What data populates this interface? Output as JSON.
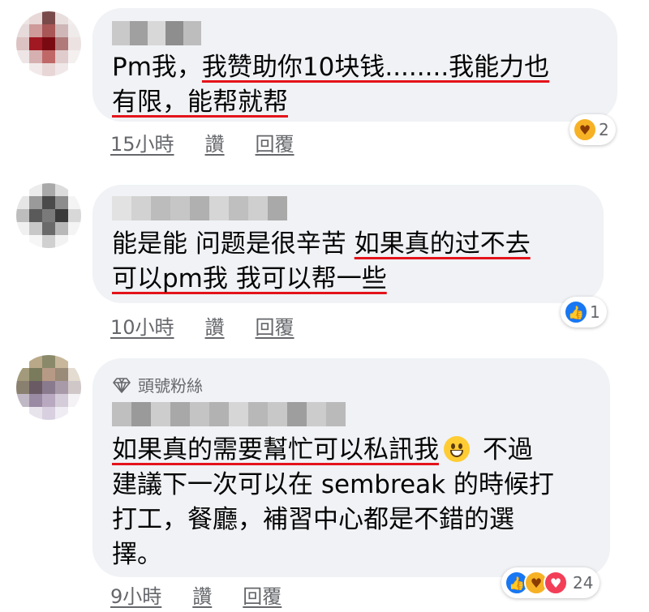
{
  "comments": [
    {
      "avatar_colors": [
        "#ede4e4",
        "#e8d8d8",
        "#7a4a4a",
        "#e8dede",
        "#f2eeee",
        "#e6dada",
        "#cf9a9a",
        "#a85656",
        "#cfb7b7",
        "#f0ebeb",
        "#dcc2c2",
        "#a01822",
        "#7a0a12",
        "#b07a7a",
        "#ede2e2",
        "#eee6e6",
        "#d6b0b0",
        "#c06868",
        "#e0cccc",
        "#f4f0f0",
        "#ffffff",
        "#f2eaea",
        "#e8d6d6",
        "#f0e8e8",
        "#ffffff"
      ],
      "line1_plain": "Pm我，",
      "line1_underlined": "我赞助你10块钱........我能力也",
      "line2_underlined": "有限，能帮就帮",
      "time": "15小時",
      "like_label": "讚",
      "reply_label": "回覆",
      "reaction_count": "2",
      "reactions": [
        "care-icon"
      ]
    },
    {
      "avatar_colors": [
        "#ffffff",
        "#ececec",
        "#a9a9a9",
        "#dcdcdc",
        "#ffffff",
        "#e6e6e6",
        "#9a9a9a",
        "#4a4a4a",
        "#8c8c8c",
        "#f4f4f4",
        "#bdbdbd",
        "#5a5a5a",
        "#7a7a7a",
        "#3a3a3a",
        "#d8d8d8",
        "#f0f0f0",
        "#c8c8c8",
        "#6a6a6a",
        "#b8b8b8",
        "#f4f4f4",
        "#ffffff",
        "#f6f6f6",
        "#d0d0d0",
        "#f2f2f2",
        "#ffffff"
      ],
      "line1_plain": "能是能 问题是很辛苦 ",
      "line1_underlined": "如果真的过不去",
      "line2_underlined": "可以pm我 我可以帮一些",
      "time": "10小時",
      "like_label": "讚",
      "reply_label": "回覆",
      "reaction_count": "1",
      "reactions": [
        "like-icon"
      ]
    },
    {
      "avatar_colors": [
        "#ffffff",
        "#b9a988",
        "#8a8a6a",
        "#c8b79a",
        "#ffffff",
        "#a29a7a",
        "#7a7a5c",
        "#b79a86",
        "#9a8a78",
        "#e4dcd0",
        "#8a8070",
        "#6a5a64",
        "#8a7a8e",
        "#a89aa8",
        "#d0c8c8",
        "#c0b8c4",
        "#9a8aa4",
        "#b8a8c0",
        "#d4ccd8",
        "#f4f2f4",
        "#ffffff",
        "#e8e4ec",
        "#d8d0e0",
        "#f0ecf4",
        "#ffffff"
      ],
      "badge": "頭號粉絲",
      "line1_underlined": "如果真的需要幫忙可以私訊我",
      "line1_tail": " 不過",
      "line2": "建議下一次可以在 sembreak 的時候打",
      "line3": "打工，餐廳，補習中心都是不錯的選",
      "line4": "擇。",
      "emoji": "grinning-face-icon",
      "time": "9小時",
      "like_label": "讚",
      "reply_label": "回覆",
      "reaction_count": "24",
      "reactions": [
        "like-icon",
        "care-icon",
        "love-icon"
      ]
    }
  ]
}
